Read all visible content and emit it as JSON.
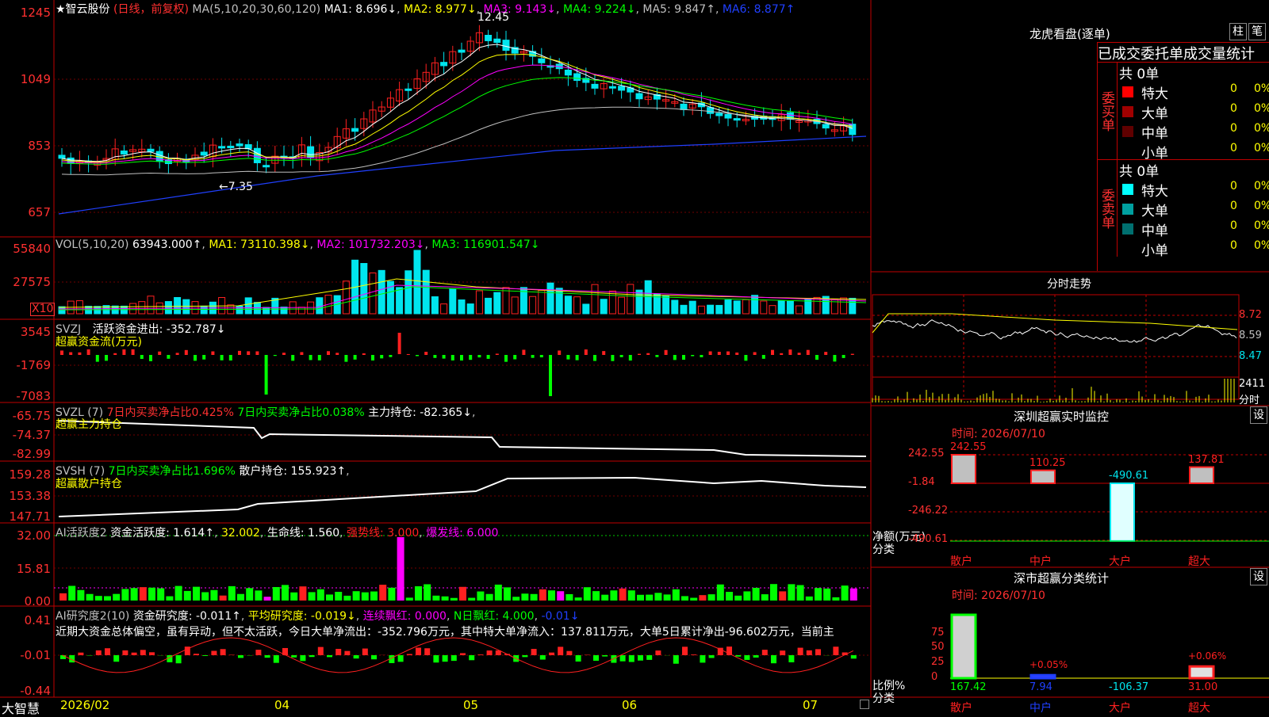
{
  "stock": {
    "title": "★智云股份",
    "mode": "(日线，前复权)",
    "ma_label": "MA(5,10,20,30,60,120)",
    "ma1": "MA1: 8.696↓",
    "ma2": "MA2: 8.977↓",
    "ma3": "MA3: 9.143↓",
    "ma4": "MA4: 9.224↓",
    "ma5": "MA5: 9.847↑",
    "ma6": "MA6: 8.877↑",
    "high_mark": "12.45",
    "low_mark": "←7.35"
  },
  "colors": {
    "up": "#ff2020",
    "down": "#00e5ee",
    "grid": "#c00000",
    "ma1": "#ffffff",
    "ma2": "#ffff00",
    "ma3": "#ff00ff",
    "ma4": "#00ff00",
    "ma5": "#c0c0c0",
    "ma6": "#2040ff"
  },
  "axes": {
    "price": [
      "1245",
      "1049",
      "853",
      "657"
    ],
    "vol": [
      "55840",
      "27575"
    ],
    "vol_unit": "X10",
    "svzj": [
      "3545",
      "-1769",
      "-7083"
    ],
    "svzl": [
      "-65.75",
      "-74.37",
      "-82.99"
    ],
    "svsh": [
      "159.28",
      "153.38",
      "147.71"
    ],
    "ai1": [
      "32.00",
      "15.81",
      "0.00"
    ],
    "ai2": [
      "0.41",
      "-0.01",
      "-0.44"
    ]
  },
  "vol": {
    "name": "VOL(5,10,20)",
    "value": "63943.000↑",
    "ma1": "MA1: 73110.398↓",
    "ma2": "MA2: 101732.203↓",
    "ma3": "MA3: 116901.547↓"
  },
  "svzj": {
    "name": "SVZJ",
    "label": "活跃资金进出: -352.787↓",
    "sub": "超赢资金流(万元)"
  },
  "svzl": {
    "name": "SVZL (7)",
    "t1": "7日内买卖净占比0.425%",
    "t2": "7日内买卖净占比0.038%",
    "t3": "主力持仓: -82.365↓",
    "sub": "超赢主力持仓"
  },
  "svsh": {
    "name": "SVSH (7)",
    "t1": "7日内买卖净占比1.696%",
    "t2": "散户持仓: 155.923↑",
    "sub": "超赢散户持仓"
  },
  "ai1": {
    "name": "AI活跃度2",
    "t1": "资金活跃度: 1.614↑",
    "t2": "32.002",
    "t3": "生命线: 1.560",
    "t4": "强势线: 3.000",
    "t5": "爆发线: 6.000"
  },
  "ai2": {
    "name": "AI研究度2(10)",
    "t1": "资金研究度: -0.011↑",
    "t2": "平均研究度: -0.019↓",
    "t3": "连续飘红: 0.000",
    "t4": "N日飘红: 4.000",
    "t5": "-0.01↓",
    "text": "近期大资金总体偏空，虽有异动，但不太活跃，今日大单净流出：-352.796万元，其中特大单净流入：137.811万元，大单5日累计净出-96.602万元，当前主"
  },
  "bottom": {
    "brand": "大智慧",
    "dates": [
      "2026/02",
      "04",
      "05",
      "06",
      "07"
    ]
  },
  "lhb": {
    "title": "龙虎看盘(逐单)",
    "btn1": "柱",
    "btn2": "笔",
    "header": "已成交委托单成交量统计",
    "buy_label": "委买单",
    "sell_label": "委卖单",
    "buy_total": "共 0单",
    "sell_total": "共 0单",
    "buy": [
      {
        "name": "特大",
        "color": "#ff0000",
        "n": "0",
        "p": "0%"
      },
      {
        "name": "大单",
        "color": "#a00000",
        "n": "0",
        "p": "0%"
      },
      {
        "name": "中单",
        "color": "#600000",
        "n": "0",
        "p": "0%"
      },
      {
        "name": "小单",
        "color": "",
        "n": "0",
        "p": "0%"
      }
    ],
    "sell": [
      {
        "name": "特大",
        "color": "#00ffff",
        "n": "0",
        "p": "0%"
      },
      {
        "name": "大单",
        "color": "#00a0a0",
        "n": "0",
        "p": "0%"
      },
      {
        "name": "中单",
        "color": "#007070",
        "n": "0",
        "p": "0%"
      },
      {
        "name": "小单",
        "color": "",
        "n": "0",
        "p": "0%"
      }
    ]
  },
  "intraday": {
    "title": "分时走势",
    "p1": "8.72",
    "p2": "8.59",
    "p3": "8.47",
    "v": "2411",
    "vu": "分时"
  },
  "monitor": {
    "title": "深圳超赢实时监控",
    "settings": "设",
    "time": "时间: 2026/07/10",
    "axis": [
      "242.55",
      "-1.84",
      "-246.22",
      "-490.61"
    ],
    "unit1": "净额(万元)",
    "unit2": "分类",
    "cats": [
      "散户",
      "中户",
      "大户",
      "超大"
    ],
    "values": [
      242.55,
      110.25,
      -490.61,
      137.81
    ],
    "value_labels": [
      "242.55",
      "110.25",
      "-490.61",
      "137.81"
    ]
  },
  "classify": {
    "title": "深市超赢分类统计",
    "settings": "设",
    "time": "时间: 2026/07/10",
    "axis": [
      "75",
      "50",
      "25",
      "0"
    ],
    "unit1": "比例%",
    "unit2": "分类",
    "cats": [
      "散户",
      "中户",
      "大户",
      "超大"
    ],
    "values": [
      167.42,
      7.94,
      -106.37,
      31.0
    ],
    "value_labels": [
      "167.42",
      "7.94",
      "-106.37",
      "31.00"
    ],
    "pct_labels": [
      "",
      "+0.05%",
      "",
      "+0.06%"
    ]
  }
}
